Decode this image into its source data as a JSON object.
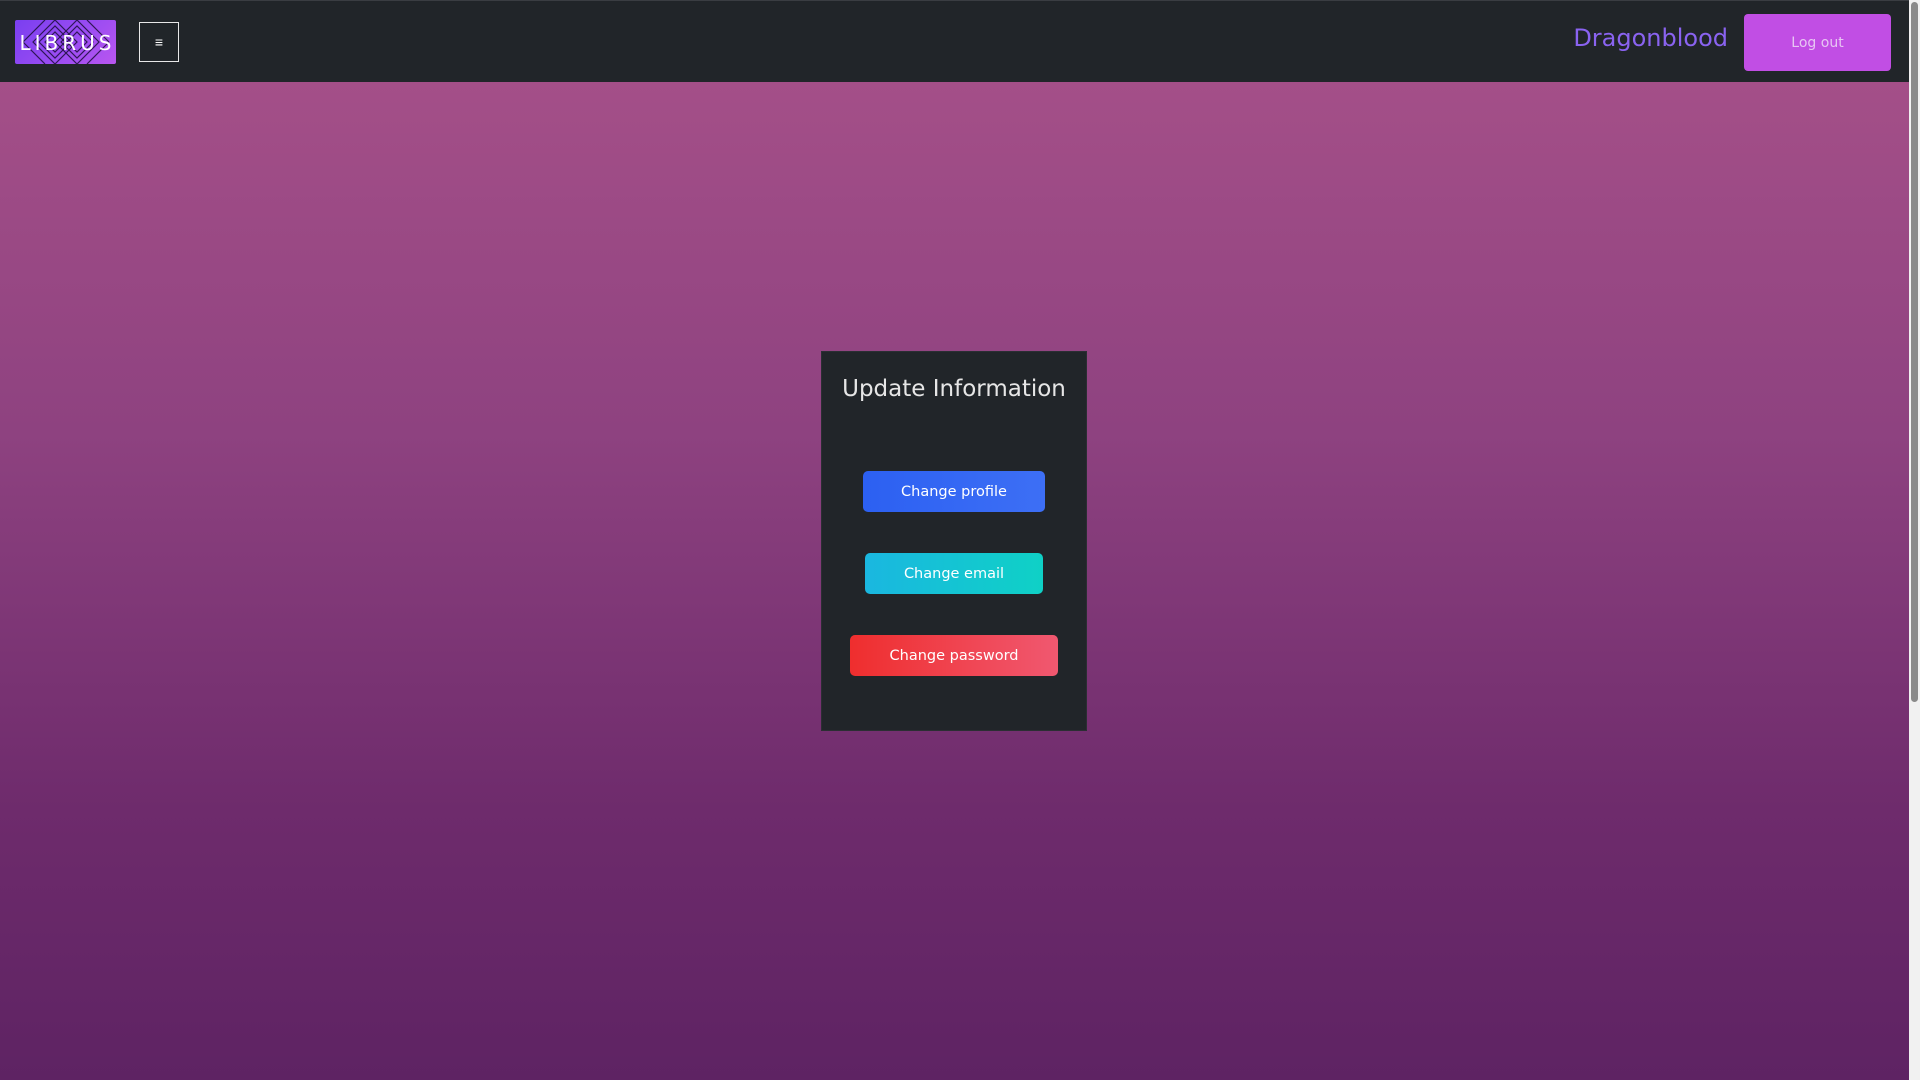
{
  "header": {
    "logo_text": "LIBRUS",
    "menu_icon": "≡",
    "username": "Dragonblood",
    "logout_label": "Log out"
  },
  "card": {
    "title": "Update Information",
    "buttons": {
      "change_profile": "Change profile",
      "change_email": "Change email",
      "change_password": "Change password"
    }
  },
  "colors": {
    "navbar_bg": "#212529",
    "page_gradient_top": "#a9528a",
    "page_gradient_bottom": "#5e2363",
    "username": "#8a63f0",
    "logout_bg": "#c14ee4",
    "profile_button": "#2c60f2",
    "email_button": "#0fd1c6",
    "password_button": "#ef2e2e"
  },
  "icons": {
    "logo": "librus-logo",
    "menu": "hamburger-menu-icon"
  }
}
